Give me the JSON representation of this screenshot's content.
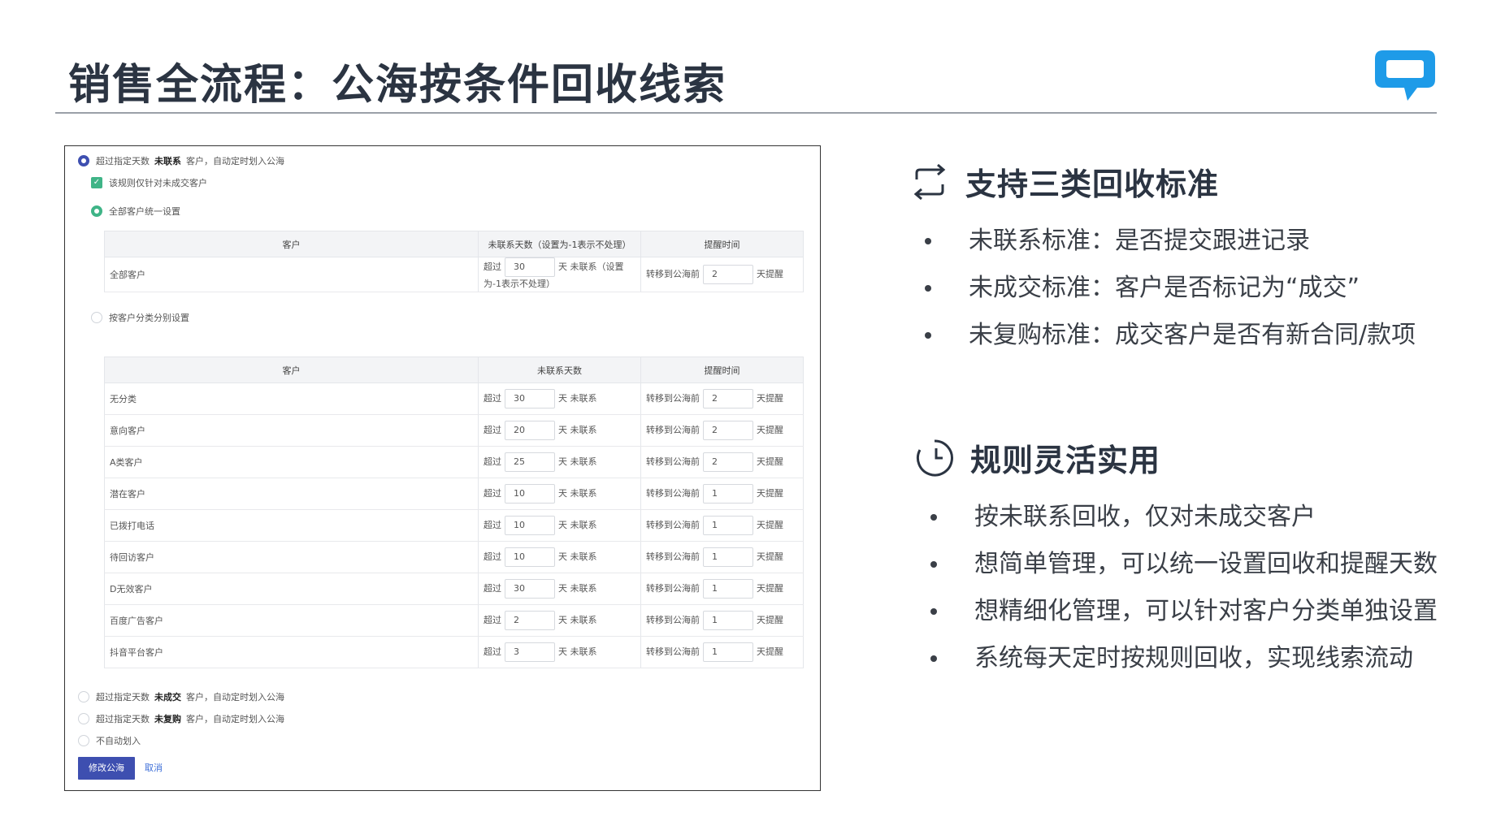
{
  "slide": {
    "title": "销售全流程：公海按条件回收线索"
  },
  "panel": {
    "opt_uncontacted": {
      "prefix": "超过指定天数",
      "keyword": "未联系",
      "suffix": "客户，自动定时划入公海"
    },
    "check_only_unclosed": "该规则仅针对未成交客户",
    "opt_unified": "全部客户统一设置",
    "table1": {
      "headers": [
        "客户",
        "未联系天数（设置为-1表示不处理）",
        "提醒时间"
      ],
      "row": {
        "customer": "全部客户",
        "before": "超过",
        "days": "30",
        "after": "天 未联系（设置为-1表示不处理）",
        "remind_before": "转移到公海前",
        "remind_days": "2",
        "remind_after": "天提醒"
      }
    },
    "opt_by_category": "按客户分类分别设置",
    "table2": {
      "headers": [
        "客户",
        "未联系天数",
        "提醒时间"
      ],
      "before": "超过",
      "after": "天 未联系",
      "remind_before": "转移到公海前",
      "remind_after": "天提醒",
      "rows": [
        {
          "customer": "无分类",
          "days": "30",
          "remind": "2"
        },
        {
          "customer": "意向客户",
          "days": "20",
          "remind": "2"
        },
        {
          "customer": "A类客户",
          "days": "25",
          "remind": "2"
        },
        {
          "customer": "潜在客户",
          "days": "10",
          "remind": "1"
        },
        {
          "customer": "已拨打电话",
          "days": "10",
          "remind": "1"
        },
        {
          "customer": "待回访客户",
          "days": "10",
          "remind": "1"
        },
        {
          "customer": "D无效客户",
          "days": "30",
          "remind": "1"
        },
        {
          "customer": "百度广告客户",
          "days": "2",
          "remind": "1"
        },
        {
          "customer": "抖音平台客户",
          "days": "3",
          "remind": "1"
        }
      ]
    },
    "opt_unclosed": {
      "prefix": "超过指定天数",
      "keyword": "未成交",
      "suffix": "客户，自动定时划入公海"
    },
    "opt_no_repurchase": {
      "prefix": "超过指定天数",
      "keyword": "未复购",
      "suffix": "客户，自动定时划入公海"
    },
    "opt_no_auto": "不自动划入",
    "save_label": "修改公海",
    "cancel_label": "取消"
  },
  "section1": {
    "heading": "支持三类回收标准",
    "icon": "repeat-icon",
    "bullets": [
      "未联系标准：是否提交跟进记录",
      "未成交标准：客户是否标记为“成交”",
      "未复购标准：成交客户是否有新合同/款项"
    ]
  },
  "section2": {
    "heading": "规则灵活实用",
    "icon": "clock-icon",
    "bullets": [
      "按未联系回收，仅对未成交客户",
      "想简单管理，可以统一设置回收和提醒天数",
      "想精细化管理，可以针对客户分类单独设置",
      "系统每天定时按规则回收，实现线索流动"
    ]
  },
  "colors": {
    "primary": "#3e4fb0",
    "green": "#3fb487",
    "logo": "#1e9be8",
    "title": "#2b3442"
  }
}
